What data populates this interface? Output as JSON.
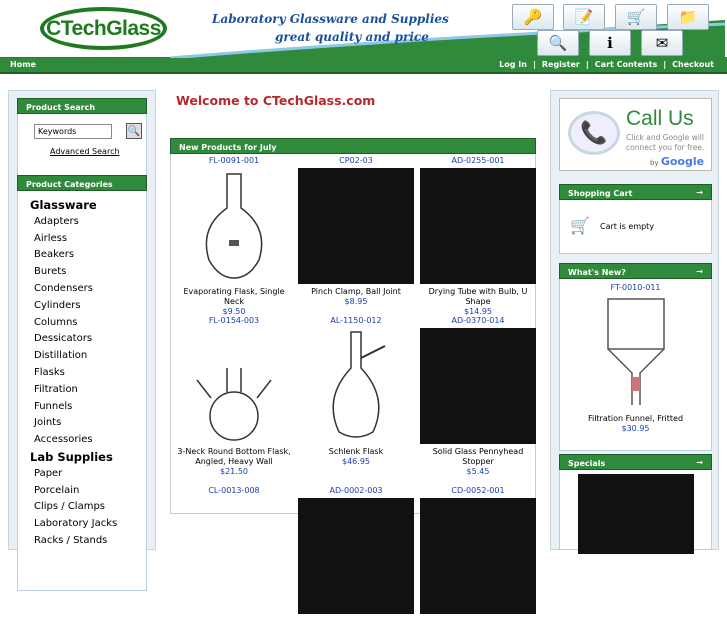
{
  "header": {
    "logo": "CTechGlass",
    "tagline1": "Laboratory Glassware and Supplies",
    "tagline2": "great quality and price",
    "icons": [
      "key-icon",
      "notepad-icon",
      "cart-icon",
      "folder-icon",
      "magnifier-icon",
      "info-icon",
      "envelope-icon"
    ]
  },
  "nav": {
    "home": "Home",
    "login": "Log In",
    "register": "Register",
    "cart_contents": "Cart Contents",
    "checkout": "Checkout",
    "sep": "|"
  },
  "search": {
    "title": "Product Search",
    "placeholder": "Keywords",
    "advanced": "Advanced Search"
  },
  "categories": {
    "title": "Product Categories",
    "items": [
      {
        "label": "Glassware",
        "big": true
      },
      {
        "label": "Adapters"
      },
      {
        "label": "Airless"
      },
      {
        "label": "Beakers"
      },
      {
        "label": "Burets"
      },
      {
        "label": "Condensers"
      },
      {
        "label": "Cylinders"
      },
      {
        "label": "Columns"
      },
      {
        "label": "Dessicators"
      },
      {
        "label": "Distillation"
      },
      {
        "label": "Flasks"
      },
      {
        "label": "Filtration"
      },
      {
        "label": "Funnels"
      },
      {
        "label": "Joints"
      },
      {
        "label": "Accessories"
      },
      {
        "label": "Lab Supplies",
        "big": true
      },
      {
        "label": "Paper"
      },
      {
        "label": "Porcelain"
      },
      {
        "label": "Clips / Clamps"
      },
      {
        "label": "Laboratory Jacks"
      },
      {
        "label": "Racks / Stands"
      }
    ]
  },
  "main": {
    "welcome": "Welcome to CTechGlass.com",
    "new_products_title": "New Products for July",
    "products": [
      {
        "id": "FL-0091-001",
        "name": "Evaporating Flask, Single Neck",
        "price": "$9.50",
        "dark": false
      },
      {
        "id": "CP02-03",
        "name": "Pinch Clamp, Ball Joint",
        "price": "$8.95",
        "dark": true
      },
      {
        "id": "AD-0255-001",
        "name": "Drying Tube with Bulb, U Shape",
        "price": "$14.95",
        "dark": true
      },
      {
        "id": "FL-0154-003",
        "name": "3-Neck Round Bottom Flask, Angled, Heavy Wall",
        "price": "$21.50",
        "dark": false
      },
      {
        "id": "AL-1150-012",
        "name": "Schlenk Flask",
        "price": "$46.95",
        "dark": false
      },
      {
        "id": "AD-0370-014",
        "name": "Solid Glass Pennyhead Stopper",
        "price": "$5.45",
        "dark": true
      },
      {
        "id": "CL-0013-008",
        "name": "",
        "price": "",
        "dark": false
      },
      {
        "id": "AD-0002-003",
        "name": "",
        "price": "",
        "dark": true
      },
      {
        "id": "CD-0052-001",
        "name": "",
        "price": "",
        "dark": true
      }
    ]
  },
  "right": {
    "call_title": "Call Us",
    "call_sub": "Click and Google will connect you for free.",
    "call_by": "by",
    "call_google": "Google",
    "cart_title": "Shopping Cart",
    "cart_text": "Cart is empty",
    "whats_title": "What's New?",
    "whats_id": "FT-0010-011",
    "whats_name": "Filtration Funnel, Fritted",
    "whats_price": "$30.95",
    "specials_title": "Specials",
    "arrow": "→"
  }
}
